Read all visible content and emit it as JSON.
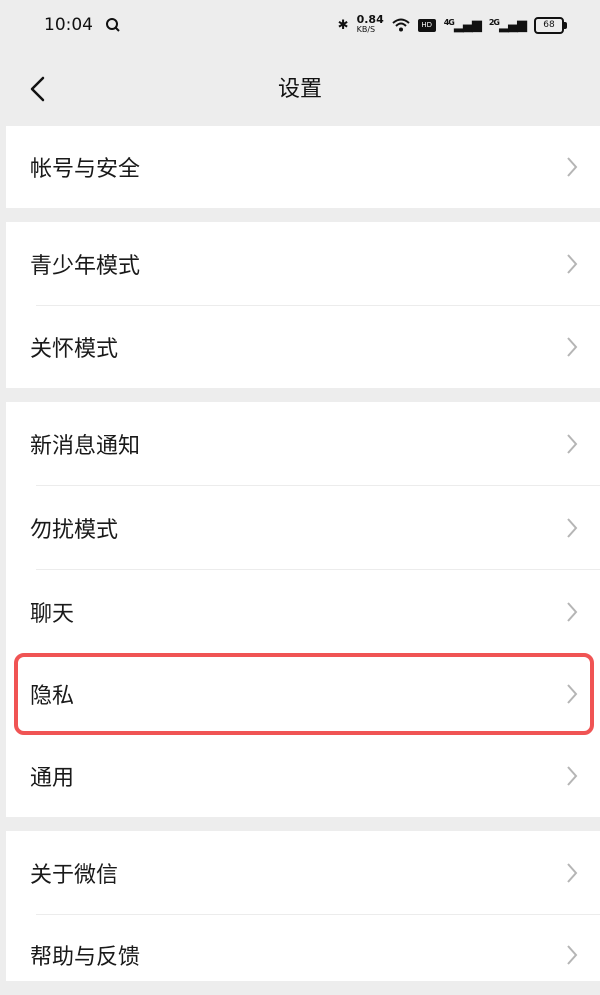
{
  "status_bar": {
    "time": "10:04",
    "search_glyph": "search-icon",
    "speed_value": "0.84",
    "speed_unit": "KB/S",
    "signal1": "4G",
    "signal2": "2G",
    "battery": "68"
  },
  "nav": {
    "title": "设置",
    "back_icon": "chevron-left-icon"
  },
  "groups": [
    {
      "items": [
        {
          "id": "account",
          "label": "帐号与安全"
        }
      ]
    },
    {
      "items": [
        {
          "id": "youth",
          "label": "青少年模式"
        },
        {
          "id": "care",
          "label": "关怀模式"
        }
      ]
    },
    {
      "items": [
        {
          "id": "notifications",
          "label": "新消息通知"
        },
        {
          "id": "dnd",
          "label": "勿扰模式"
        },
        {
          "id": "chat",
          "label": "聊天"
        },
        {
          "id": "privacy",
          "label": "隐私",
          "highlighted": true
        },
        {
          "id": "general",
          "label": "通用"
        }
      ]
    },
    {
      "items": [
        {
          "id": "about",
          "label": "关于微信"
        },
        {
          "id": "help",
          "label": "帮助与反馈"
        }
      ]
    }
  ],
  "colors": {
    "background": "#ededed",
    "row": "#ffffff",
    "highlight": "#f05454",
    "chevron": "#b5b5b5"
  }
}
